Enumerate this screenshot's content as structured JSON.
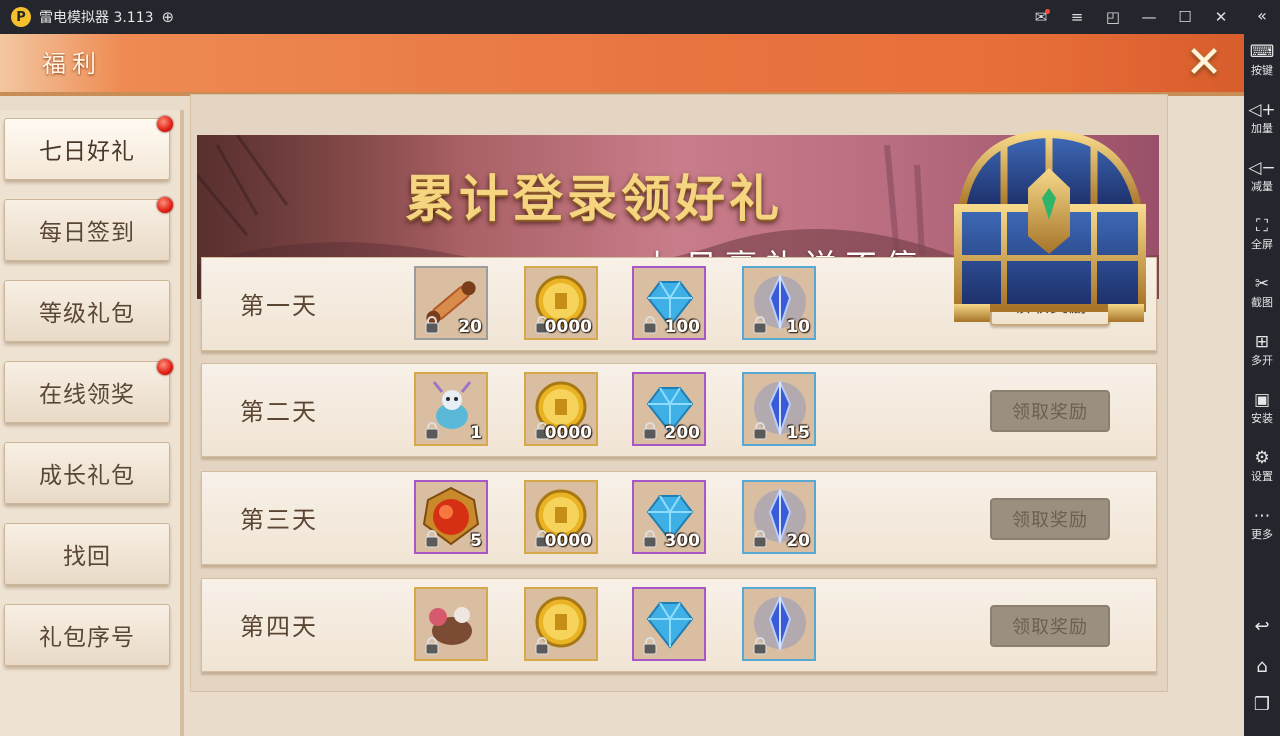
{
  "emulator": {
    "title": "雷电模拟器 3.113",
    "sidebar": [
      {
        "icon": "keyboard-icon",
        "label": "按键"
      },
      {
        "icon": "volume-up-icon",
        "label": "加量"
      },
      {
        "icon": "volume-down-icon",
        "label": "减量"
      },
      {
        "icon": "fullscreen-icon",
        "label": "全屏"
      },
      {
        "icon": "scissors-icon",
        "label": "截图"
      },
      {
        "icon": "multi-open-icon",
        "label": "多开"
      },
      {
        "icon": "apk-install-icon",
        "label": "安装"
      },
      {
        "icon": "gear-icon",
        "label": "设置"
      },
      {
        "icon": "more-icon",
        "label": "更多"
      }
    ]
  },
  "game": {
    "header_title": "福利",
    "menu": [
      {
        "label": "七日好礼",
        "dot": true,
        "active": true
      },
      {
        "label": "每日签到",
        "dot": true,
        "active": false
      },
      {
        "label": "等级礼包",
        "dot": false,
        "active": false
      },
      {
        "label": "在线领奖",
        "dot": true,
        "active": false
      },
      {
        "label": "成长礼包",
        "dot": false,
        "active": false
      },
      {
        "label": "找回",
        "dot": false,
        "active": false
      },
      {
        "label": "礼包序号",
        "dot": false,
        "active": false
      }
    ],
    "banner": {
      "title": "累计登录领好礼",
      "subtitle": "七日豪礼送不停"
    },
    "claim_label": "领取奖励",
    "days": [
      {
        "label": "第一天",
        "claimable": true,
        "rewards": [
          {
            "icon": "scroll-icon",
            "qty": "20",
            "frame": "gray"
          },
          {
            "icon": "gold-coin-icon",
            "qty": "0000",
            "frame": "gold"
          },
          {
            "icon": "blue-diamond-icon",
            "qty": "100",
            "frame": "purple"
          },
          {
            "icon": "blue-crystal-icon",
            "qty": "10",
            "frame": "blue"
          }
        ]
      },
      {
        "label": "第二天",
        "claimable": false,
        "rewards": [
          {
            "icon": "pet-creature-icon",
            "qty": "1",
            "frame": "gold"
          },
          {
            "icon": "gold-coin-icon",
            "qty": "0000",
            "frame": "gold"
          },
          {
            "icon": "blue-diamond-icon",
            "qty": "200",
            "frame": "purple"
          },
          {
            "icon": "blue-crystal-icon",
            "qty": "15",
            "frame": "blue"
          }
        ]
      },
      {
        "label": "第三天",
        "claimable": false,
        "rewards": [
          {
            "icon": "red-orb-icon",
            "qty": "5",
            "frame": "purple"
          },
          {
            "icon": "gold-coin-icon",
            "qty": "0000",
            "frame": "gold"
          },
          {
            "icon": "blue-diamond-icon",
            "qty": "300",
            "frame": "purple"
          },
          {
            "icon": "blue-crystal-icon",
            "qty": "20",
            "frame": "blue"
          }
        ]
      },
      {
        "label": "第四天",
        "claimable": false,
        "rewards": [
          {
            "icon": "mount-icon",
            "qty": "",
            "frame": "gold"
          },
          {
            "icon": "gold-coin-icon",
            "qty": "",
            "frame": "gold"
          },
          {
            "icon": "blue-diamond-icon",
            "qty": "",
            "frame": "purple"
          },
          {
            "icon": "blue-crystal-icon",
            "qty": "",
            "frame": "blue"
          }
        ]
      }
    ]
  }
}
